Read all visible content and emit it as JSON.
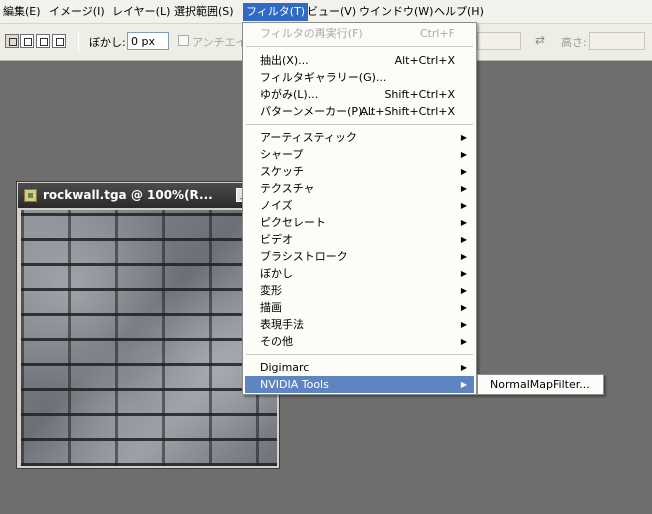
{
  "menubar": {
    "items": [
      {
        "label": "編集(E)"
      },
      {
        "label": "イメージ(I)"
      },
      {
        "label": "レイヤー(L)"
      },
      {
        "label": "選択範囲(S)"
      },
      {
        "label": "フィルタ(T)"
      },
      {
        "label": "ビュー(V)"
      },
      {
        "label": "ウインドウ(W)"
      },
      {
        "label": "ヘルプ(H)"
      }
    ],
    "active_index": 4
  },
  "options": {
    "feather_label": "ぼかし:",
    "feather_value": "0 px",
    "antialias_label": "アンチエイリ",
    "height_label": "高さ:"
  },
  "document": {
    "title": "rockwall.tga @ 100%(R..."
  },
  "filter_menu": {
    "last_filter": {
      "label": "フィルタの再実行(F)",
      "shortcut": "Ctrl+F"
    },
    "items1": [
      {
        "label": "抽出(X)...",
        "shortcut": "Alt+Ctrl+X"
      },
      {
        "label": "フィルタギャラリー(G)...",
        "shortcut": ""
      },
      {
        "label": "ゆがみ(L)...",
        "shortcut": "Shift+Ctrl+X"
      },
      {
        "label": "パターンメーカー(P)...",
        "shortcut": "Alt+Shift+Ctrl+X"
      }
    ],
    "submenus": [
      {
        "label": "アーティスティック"
      },
      {
        "label": "シャープ"
      },
      {
        "label": "スケッチ"
      },
      {
        "label": "テクスチャ"
      },
      {
        "label": "ノイズ"
      },
      {
        "label": "ピクセレート"
      },
      {
        "label": "ビデオ"
      },
      {
        "label": "ブラシストローク"
      },
      {
        "label": "ぼかし"
      },
      {
        "label": "変形"
      },
      {
        "label": "描画"
      },
      {
        "label": "表現手法"
      },
      {
        "label": "その他"
      }
    ],
    "plugins": [
      {
        "label": "Digimarc"
      },
      {
        "label": "NVIDIA Tools"
      }
    ],
    "selected_index": 1
  },
  "nvidia_submenu": {
    "items": [
      {
        "label": "NormalMapFilter..."
      }
    ]
  },
  "icons": {
    "submenu_arrow": "▶",
    "swap": "⇄",
    "minimize": "_",
    "maximize": "□"
  },
  "colors": {
    "workspace": "#6e6e6e",
    "highlight": "#5e85c2",
    "menu_active": "#316ac5"
  }
}
